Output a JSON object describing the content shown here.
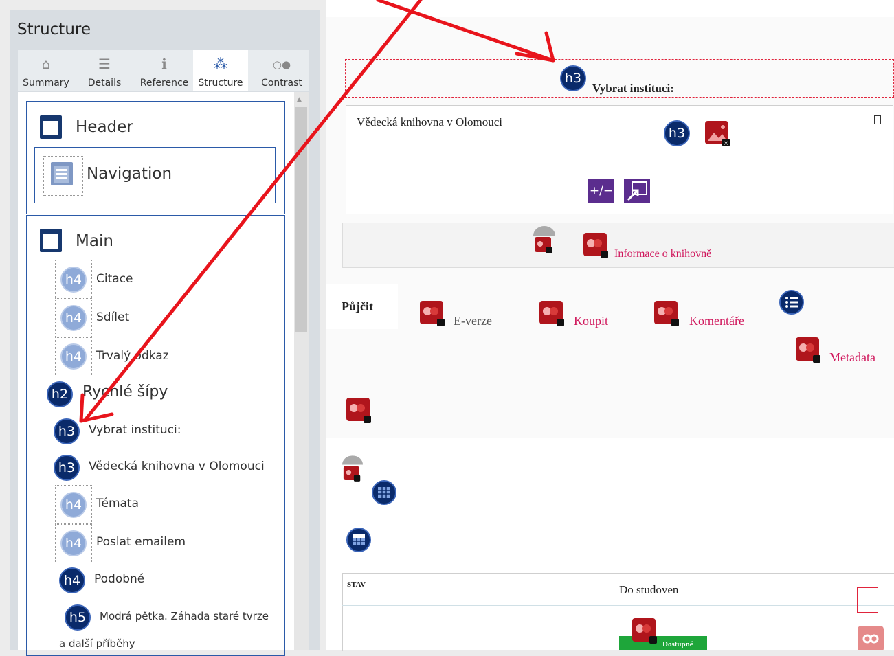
{
  "sidebar": {
    "title": "Structure",
    "tabs": [
      {
        "label": "Summary",
        "icon": "home-icon",
        "glyph": "⌂"
      },
      {
        "label": "Details",
        "icon": "list-icon",
        "glyph": "☰"
      },
      {
        "label": "Reference",
        "icon": "info-icon",
        "glyph": "ℹ"
      },
      {
        "label": "Structure",
        "icon": "sitemap-icon",
        "glyph": "⁂"
      },
      {
        "label": "Contrast",
        "icon": "toggle-icon",
        "glyph": "○●"
      }
    ],
    "landmarks": {
      "header": "Header",
      "navigation": "Navigation",
      "main": "Main"
    },
    "headings": [
      {
        "level": "h4",
        "text": "Citace"
      },
      {
        "level": "h4",
        "text": "Sdílet"
      },
      {
        "level": "h4",
        "text": "Trvalý odkaz"
      },
      {
        "level": "h2",
        "text": "Rychlé šípy"
      },
      {
        "level": "h3",
        "text": "Vybrat instituci:"
      },
      {
        "level": "h3",
        "text": "Vědecká knihovna v Olomouci"
      },
      {
        "level": "h4",
        "text": "Témata"
      },
      {
        "level": "h4",
        "text": "Poslat emailem"
      },
      {
        "level": "h4",
        "text": "Podobné"
      },
      {
        "level": "h5",
        "text": "Modrá pětka. Záhada staré tvrze"
      },
      {
        "level": "",
        "text": "a další příběhy"
      }
    ]
  },
  "main": {
    "heading_badge": "h3",
    "select_label": "Vybrat instituci:",
    "institution": "Vědecká knihovna v Olomouci",
    "institution_badge": "h3",
    "toolbar_icon_1": "+/−",
    "library_info_link": "Informace o knihovně",
    "tabs": {
      "borrow": "Půjčit",
      "everze": "E-verze",
      "buy": "Koupit",
      "comments": "Komentáře",
      "metadata": "Metadata"
    },
    "table": {
      "header_status": "STAV",
      "location": "Do studoven",
      "availability": "Dostupné"
    }
  },
  "colors": {
    "arrow": "#e8141c",
    "link": "#d0175c",
    "badge_dark": "#0a2a6a",
    "badge_light": "#8faad8",
    "available": "#1ea63a",
    "highlight_box": "#e0243c"
  }
}
